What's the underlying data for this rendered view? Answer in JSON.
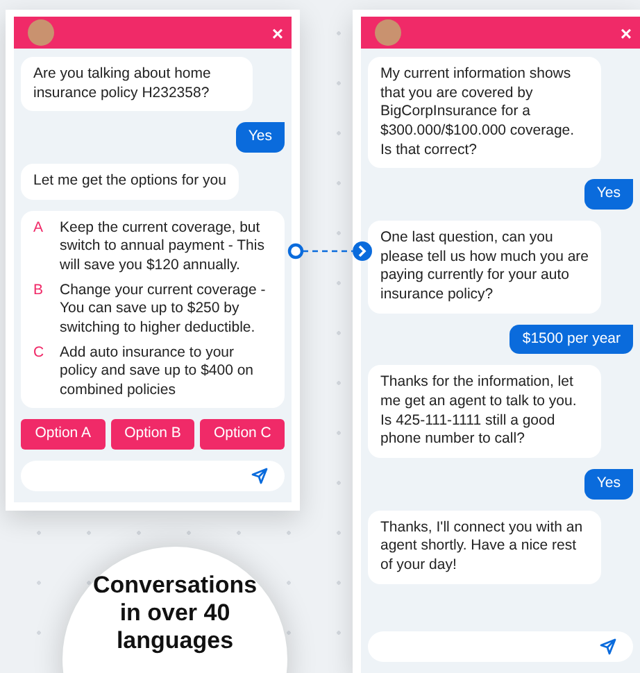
{
  "left_chat": {
    "close": "×",
    "messages": [
      {
        "kind": "bot",
        "text": "Are you talking about home insurance policy H232358?"
      },
      {
        "kind": "user",
        "text": "Yes"
      },
      {
        "kind": "bot",
        "text": "Let me get the options for you"
      },
      {
        "kind": "options",
        "items": [
          {
            "letter": "A",
            "text": "Keep the current coverage, but switch to annual payment - This will save you $120 annually."
          },
          {
            "letter": "B",
            "text": "Change your current coverage - You can save up to $250 by switching to higher deductible."
          },
          {
            "letter": "C",
            "text": "Add auto insurance to your policy and save up to $400 on combined policies"
          }
        ]
      }
    ],
    "quick_replies": [
      "Option A",
      "Option B",
      "Option C"
    ]
  },
  "right_chat": {
    "close": "×",
    "messages": [
      {
        "kind": "bot",
        "text": "My current information shows that you are covered by BigCorpInsurance for a $300.000/$100.000 coverage. Is that correct?"
      },
      {
        "kind": "user",
        "text": "Yes"
      },
      {
        "kind": "bot",
        "text": "One last question, can you please tell us how much you are paying currently for your auto insurance policy?"
      },
      {
        "kind": "user",
        "text": "$1500 per year"
      },
      {
        "kind": "bot",
        "text": "Thanks for the information, let me get an agent to talk to you. Is 425-111-1111 still a good phone number to call?"
      },
      {
        "kind": "user",
        "text": "Yes"
      },
      {
        "kind": "bot",
        "text": "Thanks, I'll connect you with an agent shortly. Have a nice rest of your day!"
      }
    ]
  },
  "banner": {
    "text": "Conversations in over 40 languages"
  }
}
